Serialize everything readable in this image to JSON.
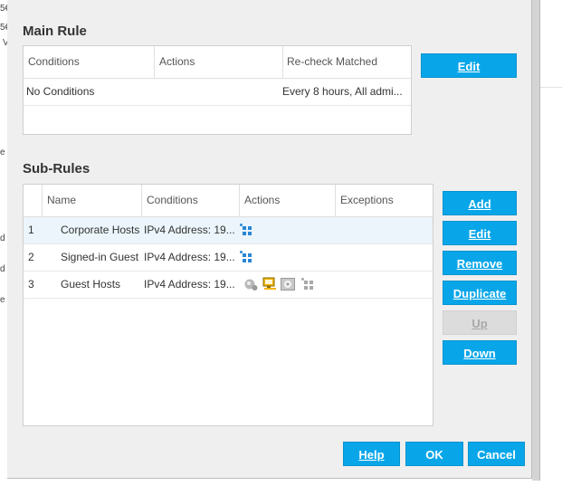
{
  "background": {
    "fragments": [
      "5€",
      "5€",
      "V",
      "e",
      "d",
      "d",
      "e"
    ]
  },
  "main_rule": {
    "title": "Main Rule",
    "columns": [
      "Conditions",
      "Actions",
      "Re-check",
      "Matched"
    ],
    "rows": [
      {
        "conditions": "No Conditions",
        "recheck_matched": "Every 8 hours, All admi..."
      }
    ],
    "edit_label": "Edit"
  },
  "sub_rules": {
    "title": "Sub-Rules",
    "columns": [
      "Name",
      "Conditions",
      "Actions",
      "Exceptions"
    ],
    "rows": [
      {
        "index": "1",
        "name": "Corporate Hosts",
        "conditions": "IPv4 Address: 19...",
        "actions": [
          "enforcement-icon"
        ]
      },
      {
        "index": "2",
        "name": "Signed-in Guest",
        "conditions": "IPv4 Address: 19...",
        "actions": [
          "enforcement-icon"
        ]
      },
      {
        "index": "3",
        "name": "Guest Hosts",
        "conditions": "IPv4 Address: 19...",
        "actions": [
          "guest-action-icon",
          "monitor-action-icon",
          "disk-action-icon",
          "enforcement-icon"
        ]
      }
    ],
    "buttons": {
      "add": "Add",
      "edit": "Edit",
      "remove": "Remove",
      "duplicate": "Duplicate",
      "up": "Up",
      "down": "Down"
    }
  },
  "footer": {
    "help": "Help",
    "ok": "OK",
    "cancel": "Cancel"
  },
  "colors": {
    "accent": "#08a6e9",
    "selected_row": "#ebf5fb",
    "dialog_bg": "#efefef"
  }
}
